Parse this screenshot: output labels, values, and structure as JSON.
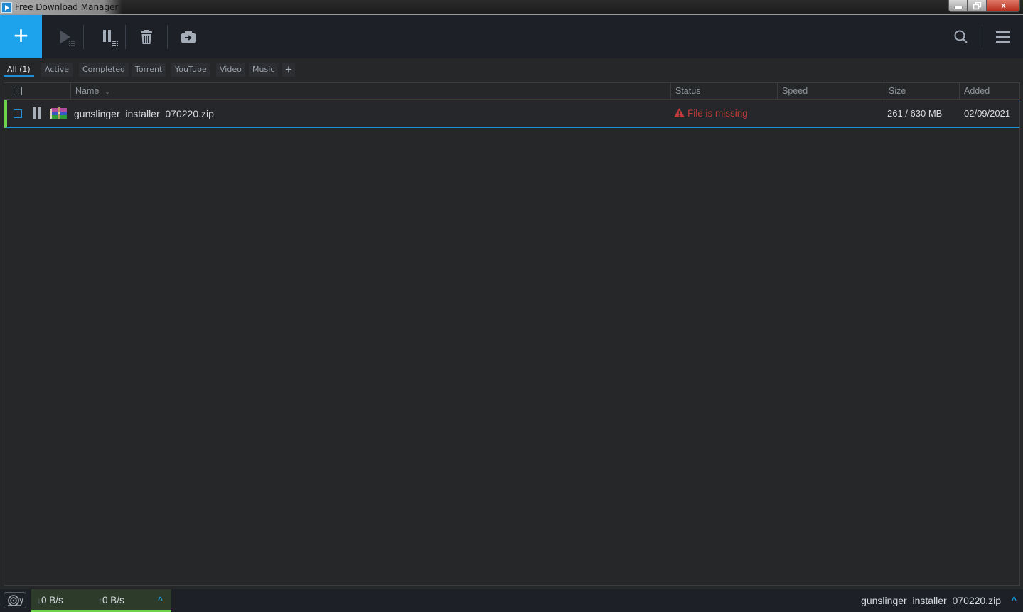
{
  "window": {
    "title": "Free Download Manager",
    "minimize_icon": "minimize-icon",
    "maximize_icon": "restore-icon",
    "close_icon": "close-icon",
    "close_label": "x"
  },
  "toolbar": {
    "add_label": "+",
    "buttons": [
      {
        "name": "resume-all",
        "icon": "play-icon",
        "enabled": false
      },
      {
        "name": "pause-all",
        "icon": "pause-icon",
        "enabled": true
      },
      {
        "name": "delete",
        "icon": "trash-icon",
        "enabled": true
      },
      {
        "name": "move-to",
        "icon": "move-folder-icon",
        "enabled": true
      }
    ],
    "search_icon": "search-icon",
    "menu_icon": "hamburger-menu-icon"
  },
  "tabs": [
    {
      "label": "All (1)",
      "active": true
    },
    {
      "label": "Active",
      "active": false
    },
    {
      "label": "Completed",
      "active": false
    },
    {
      "label": "Torrent",
      "active": false
    },
    {
      "label": "YouTube",
      "active": false
    },
    {
      "label": "Video",
      "active": false
    },
    {
      "label": "Music",
      "active": false
    }
  ],
  "tab_add_label": "+",
  "table": {
    "columns": {
      "name": "Name",
      "status": "Status",
      "speed": "Speed",
      "size": "Size",
      "added": "Added"
    },
    "sort_indicator": "⌄",
    "rows": [
      {
        "name": "gunslinger_installer_070220.zip",
        "file_icon": "winrar-archive-icon",
        "state_icon": "pause-icon",
        "status": "File is missing",
        "status_icon": "warning-icon",
        "speed": "",
        "size": "261 / 630 MB",
        "added": "02/09/2021",
        "selected": false
      }
    ]
  },
  "statusbar": {
    "snail_icon": "snail-mode-icon",
    "download_speed": "0 B/s",
    "upload_speed": "0 B/s",
    "download_arrow": "↓",
    "upload_arrow": "↑",
    "expand_icon": "^",
    "current_file": "gunslinger_installer_070220.zip"
  },
  "colors": {
    "accent": "#1ca3ec",
    "row_border": "#1c8fd6",
    "status_error": "#c0393b",
    "active_indicator": "#6ed24a"
  }
}
